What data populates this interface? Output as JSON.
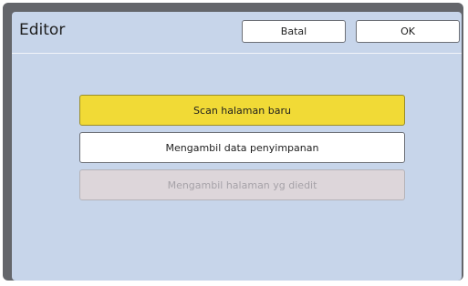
{
  "dialog": {
    "title": "Editor",
    "cancel_label": "Batal",
    "ok_label": "OK"
  },
  "options": {
    "scan_label": "Scan halaman baru",
    "load_data_label": "Mengambil data penyimpanan",
    "load_edited_label": "Mengambil halaman yg diedit"
  },
  "colors": {
    "panel_bg": "#c7d5ea",
    "frame": "#64666b",
    "highlight": "#f1da36",
    "disabled_bg": "#ddd6da"
  }
}
